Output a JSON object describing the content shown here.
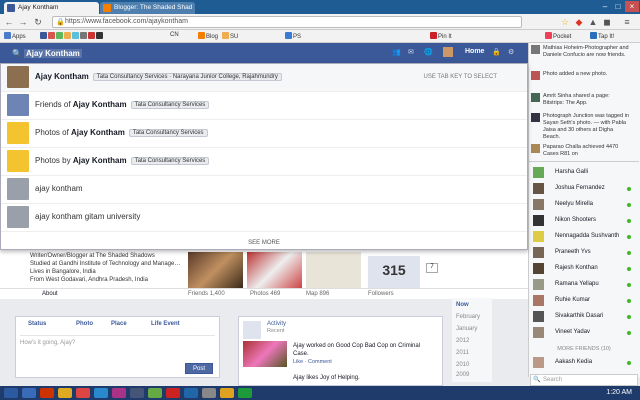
{
  "browser": {
    "tabs": [
      {
        "label": "Ajay Kontham",
        "active": true,
        "color": "#3b5998"
      },
      {
        "label": "Blogger: The Shaded Shad",
        "active": false,
        "color": "#f57d00"
      }
    ],
    "url": "https://www.facebook.com/ajaykontham",
    "bookmarks": [
      "Apps",
      "CN",
      "Blog",
      "SU",
      "PS",
      "Pin It",
      "Pocket",
      "Tap It!"
    ]
  },
  "fb": {
    "search_value": "Ajay Kontham",
    "nav": {
      "home": "Home"
    },
    "hint": "USE TAB KEY TO SELECT",
    "results": [
      {
        "prefix": "",
        "name": "Ajay Kontham",
        "chip": "Tata Consultancy Services · Narayana Junior College, Rajahmundry",
        "color": "#8b6f4e"
      },
      {
        "prefix": "Friends of ",
        "name": "Ajay Kontham",
        "chip": "Tata Consultancy Services",
        "color": "#6d84b4"
      },
      {
        "prefix": "Photos of ",
        "name": "Ajay Kontham",
        "chip": "Tata Consultancy Services",
        "color": "#f4c430"
      },
      {
        "prefix": "Photos by ",
        "name": "Ajay Kontham",
        "chip": "Tata Consultancy Services",
        "color": "#f4c430"
      },
      {
        "prefix": "",
        "name": "ajay kontham",
        "chip": "",
        "color": "#9aa0aa"
      },
      {
        "prefix": "",
        "name": "ajay kontham gitam university",
        "chip": "",
        "color": "#9aa0aa"
      }
    ],
    "see_more": "SEE MORE"
  },
  "profile": {
    "intro": [
      "Writer/Owner/Blogger at The Shaded Shadows",
      "Studied at Gandhi Institute of Technology and Manage…",
      "Lives in Bangalore, India",
      "From West Godavari, Andhra Pradesh, India"
    ],
    "about": "About",
    "stats": {
      "friends": "Friends 1,400",
      "photos": "Photos 469",
      "map": "Map 896",
      "followers": "Followers"
    },
    "followers_count": "315",
    "count_badge": "7"
  },
  "composer": {
    "tabs": [
      "Status",
      "Photo",
      "Place",
      "Life Event"
    ],
    "placeholder": "How's it going, Ajay?",
    "post": "Post"
  },
  "activity": {
    "title": "Activity",
    "sub": "Recent",
    "item1": "Ajay worked on Good Cop Bad Cop on Criminal Case.",
    "item1_meta": "Like · Comment",
    "item2": "Ajay likes Joy of Helping."
  },
  "timeline": [
    "Now",
    "February",
    "January",
    "2012",
    "2011",
    "2010",
    "2009"
  ],
  "ticker": [
    "Mathias Hoheim-Photographer and Daniele Confucio are now friends.",
    "Photo added a new photo.",
    "Amrit Sinha shared a page: Bitstrips: The App.",
    "Photograph Junction was tagged in Sayan Seth's photo. — with Pabla Jaisa and 30 others at Digha Beach.",
    "Paparao Challa achieved 4470 Cases R81 on"
  ],
  "friends": [
    {
      "name": "Harsha Galli",
      "online": false
    },
    {
      "name": "Joshua Fernandez",
      "online": true
    },
    {
      "name": "Neelyu Mirella",
      "online": true
    },
    {
      "name": "Nikon Shooters",
      "online": true
    },
    {
      "name": "Nennagadda Sushvanth",
      "online": true
    },
    {
      "name": "Praneeth Yvs",
      "online": true
    },
    {
      "name": "Rajesh Konthan",
      "online": true
    },
    {
      "name": "Ramana Yellapu",
      "online": true
    },
    {
      "name": "Ruhie Kumar",
      "online": true
    },
    {
      "name": "Sivakarthik Dasari",
      "online": true
    },
    {
      "name": "Vineet Yadav",
      "online": true
    }
  ],
  "more_friends": "MORE FRIENDS (10)",
  "extra_friend": "Aakash Kedia",
  "sidebar_search": "Search",
  "clock": "1:20 AM"
}
